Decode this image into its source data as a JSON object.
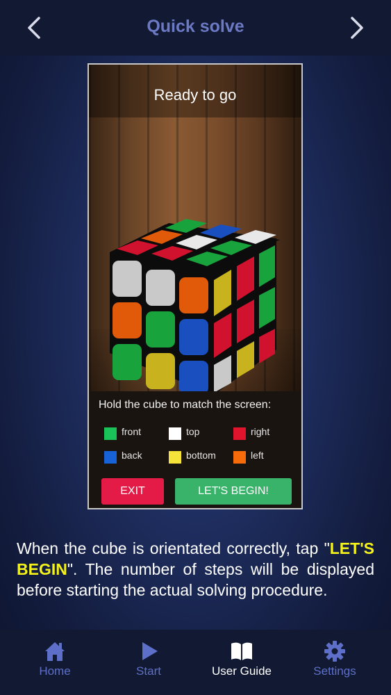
{
  "header": {
    "title": "Quick solve",
    "back_icon": "chevron-left-icon",
    "forward_icon": "chevron-right-icon"
  },
  "preview": {
    "heading": "Ready to go",
    "instruction": "Hold the cube to match the screen:",
    "legend": [
      {
        "label": "front",
        "color": "#19c35a"
      },
      {
        "label": "top",
        "color": "#ffffff"
      },
      {
        "label": "right",
        "color": "#e0142c"
      },
      {
        "label": "back",
        "color": "#1662d6"
      },
      {
        "label": "bottom",
        "color": "#f5e33a"
      },
      {
        "label": "left",
        "color": "#f86b0b"
      }
    ],
    "exit_label": "EXIT",
    "begin_label": "LET'S BEGIN!"
  },
  "description": {
    "part1": "When the cube is orientated correctly, tap \"",
    "highlight": "LET'S BEGIN",
    "part2": "\". The number of steps will be displayed before starting the actual solving procedure."
  },
  "tabs": [
    {
      "label": "Home",
      "icon": "home-icon",
      "active": false
    },
    {
      "label": "Start",
      "icon": "play-icon",
      "active": false
    },
    {
      "label": "User Guide",
      "icon": "book-icon",
      "active": true
    },
    {
      "label": "Settings",
      "icon": "gear-icon",
      "active": false
    }
  ],
  "colors": {
    "accent": "#6c79c4",
    "exit": "#e51b47",
    "begin": "#39b36a",
    "highlight": "#f4f21a"
  }
}
